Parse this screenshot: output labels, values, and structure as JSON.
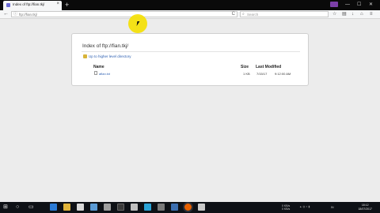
{
  "tab": {
    "title": "Index of ftp://fian.tkj/",
    "close": "×",
    "new_tab": "+"
  },
  "window_controls": {
    "minimize": "—",
    "maximize": "☐",
    "close": "✕"
  },
  "nav": {
    "back": "←",
    "info": "ⓘ",
    "url": "ftp://fian.tkj/",
    "reload": "C",
    "search_placeholder": "Search",
    "search_icon": "⌕",
    "bookmark": "☆",
    "reader": "▤",
    "download": "↓",
    "home": "⌂",
    "menu": "≡"
  },
  "listing": {
    "heading": "Index of ftp://fian.tkj/",
    "up_link": "Up to higher level directory",
    "columns": {
      "name": "Name",
      "size": "Size",
      "modified": "Last Modified"
    },
    "files": [
      {
        "name": "aflan.txt",
        "size": "1 KB",
        "date": "7/15/17",
        "time": "9:12:00 AM"
      }
    ]
  },
  "taskbar": {
    "start": "⊞",
    "search": "○",
    "task_view": "▭",
    "tray_lines": [
      "0 KB/s",
      "0 KB/s"
    ],
    "lang": "IN",
    "time": "18:12",
    "date": "18/07/2017"
  },
  "colors": {
    "accent_link": "#2a5db0",
    "cursor_highlight": "#f5e000",
    "extension": "#7b3fa7"
  }
}
